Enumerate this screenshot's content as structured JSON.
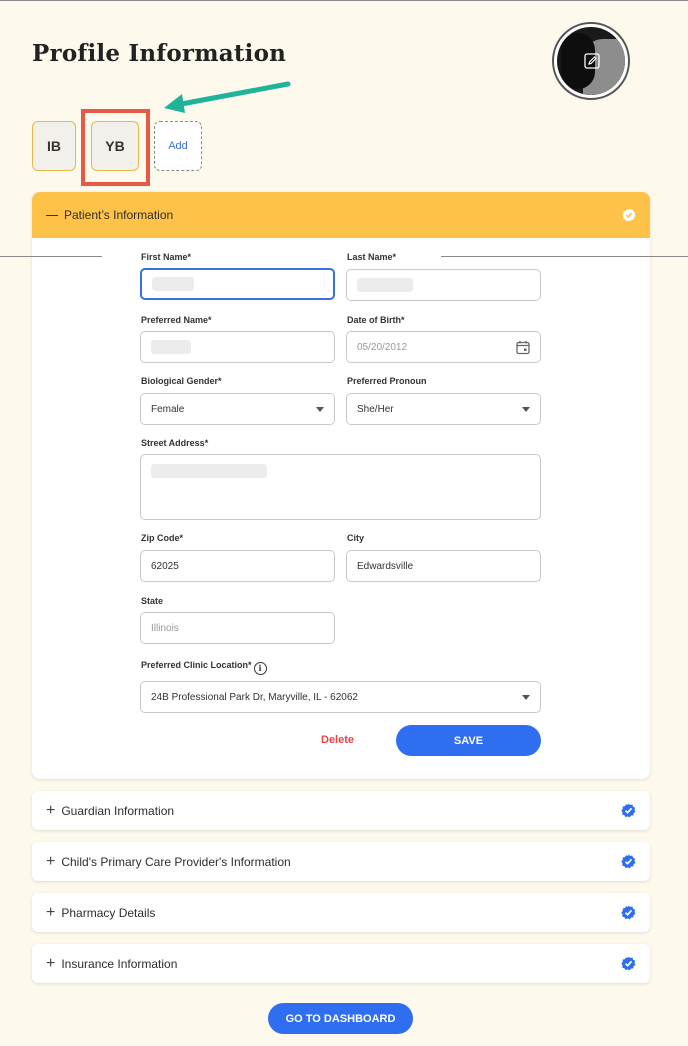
{
  "page": {
    "title": "Profile Information"
  },
  "profiles": {
    "chips": [
      "IB",
      "YB"
    ],
    "add_label": "Add"
  },
  "patient": {
    "header": "Patient’s Information",
    "first_name_label": "First Name*",
    "last_name_label": "Last Name*",
    "preferred_name_label": "Preferred Name*",
    "dob_label": "Date of Birth*",
    "dob_placeholder": "05/20/2012",
    "gender_label": "Biological Gender*",
    "gender_value": "Female",
    "pronoun_label": "Preferred Pronoun",
    "pronoun_value": "She/Her",
    "street_label": "Street Address*",
    "zip_label": "Zip Code*",
    "zip_value": "62025",
    "city_label": "City",
    "city_value": "Edwardsville",
    "state_label": "State",
    "state_placeholder": "Illinois",
    "clinic_label": "Preferred Clinic Location*",
    "clinic_value": "24B Professional Park Dr, Maryville, IL - 62062",
    "delete_label": "Delete",
    "save_label": "SAVE"
  },
  "sections": [
    {
      "label": "Guardian Information"
    },
    {
      "label": "Child's Primary Care Provider's Information"
    },
    {
      "label": "Pharmacy Details"
    },
    {
      "label": "Insurance Information"
    }
  ],
  "footer": {
    "dashboard_label": "GO TO DASHBOARD"
  },
  "colors": {
    "accent": "#fdc247",
    "primary": "#2f6ef0",
    "highlight": "#e55a44",
    "arrow": "#1fb39a",
    "delete": "#e54545"
  }
}
